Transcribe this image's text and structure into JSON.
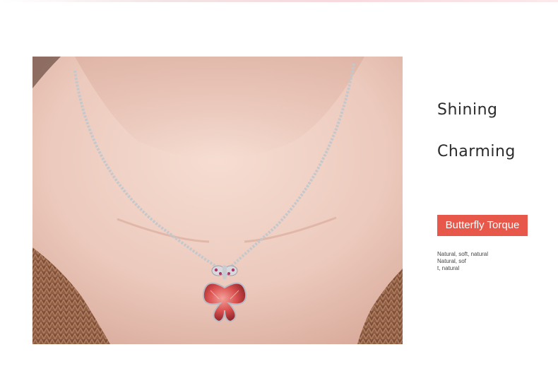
{
  "headlines": {
    "line1": "Shining",
    "line2": "Charming"
  },
  "badge": {
    "label": "Butterfly Torque",
    "color": "#e8584a"
  },
  "description": {
    "lines": [
      "Natural, soft, natural",
      "Natural, sof",
      "t, natural"
    ]
  },
  "photo": {
    "subject": "butterfly-pendant-necklace-photo",
    "colors": {
      "skin": "#efcdbf",
      "sweater": "#8a5a42",
      "chain": "#bfc3c8",
      "pendant": "#d9504f"
    }
  }
}
